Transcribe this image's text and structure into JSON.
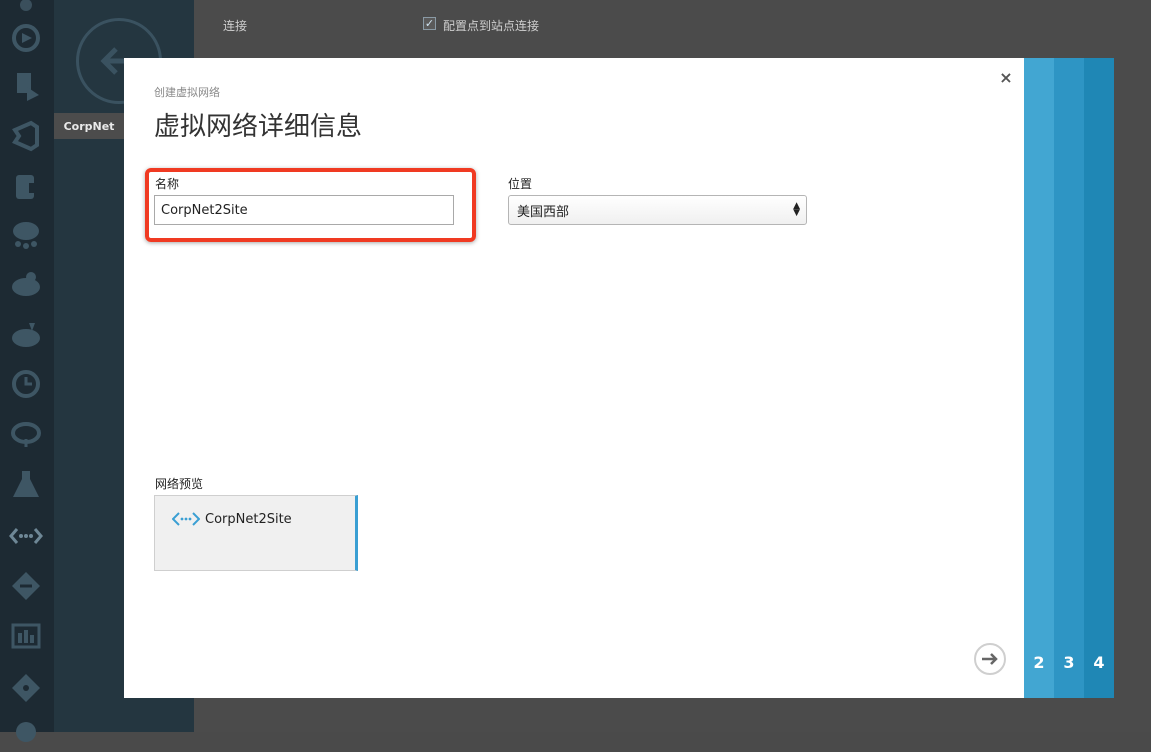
{
  "background": {
    "connection_label": "连接",
    "checkbox_checked": true,
    "checkbox_label": "配置点到站点连接",
    "corpnet_tab": "CorpNet"
  },
  "rail": {
    "icons": [
      "gear-circle-icon",
      "deploy-icon",
      "visual-studio-icon",
      "storage-icon",
      "cloud-network-icon",
      "cloud-service-icon",
      "cloud-media-icon",
      "scheduler-icon",
      "cloud-sync-icon",
      "flask-icon",
      "virtual-network-icon",
      "traffic-icon",
      "dashboard-icon",
      "git-icon",
      "add-icon"
    ]
  },
  "dialog": {
    "subtitle": "创建虚拟网络",
    "title": "虚拟网络详细信息",
    "close_label": "×",
    "name_label": "名称",
    "name_value": "CorpNet2Site",
    "location_label": "位置",
    "location_value": "美国西部",
    "preview_label": "网络预览",
    "preview_name": "CorpNet2Site"
  },
  "steps": [
    "2",
    "3",
    "4"
  ],
  "colors": {
    "accent": "#3a9fd3",
    "highlight": "#f03a22",
    "step2": "#42a6d2",
    "step3": "#2e95c4",
    "step4": "#1f87b5"
  }
}
